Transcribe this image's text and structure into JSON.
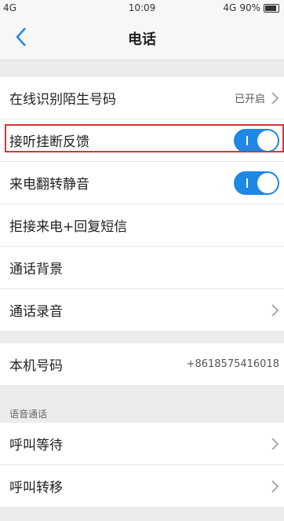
{
  "status_bar": {
    "signal": "4G",
    "time": "10:09",
    "network_right": "4G",
    "battery_percent": "90%"
  },
  "nav": {
    "title": "电话",
    "back_icon": "chevron-left-icon"
  },
  "settings": [
    {
      "label": "在线识别陌生号码",
      "value": "已开启",
      "type": "link"
    },
    {
      "label": "接听挂断反馈",
      "type": "toggle",
      "on": true
    },
    {
      "label": "来电翻转静音",
      "type": "toggle",
      "on": true
    },
    {
      "label": "拒接来电+回复短信",
      "type": "link"
    },
    {
      "label": "通话背景",
      "type": "link"
    },
    {
      "label": "通话录音",
      "type": "link"
    }
  ],
  "phone_number": {
    "label": "本机号码",
    "value": "+8618575416018"
  },
  "voice_call": {
    "header": "语音通话",
    "items": [
      {
        "label": "呼叫等待",
        "type": "link"
      },
      {
        "label": "呼叫转移",
        "type": "link"
      }
    ]
  },
  "colors": {
    "accent": "#1e88e5",
    "highlight": "#d9343a",
    "background": "#ececec"
  }
}
